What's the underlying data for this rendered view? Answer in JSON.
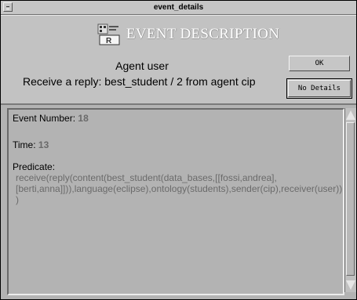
{
  "window": {
    "title": "event_details"
  },
  "header": {
    "heading": "EVENT DESCRIPTION",
    "agent_line": "Agent user",
    "reply_line": "Receive a reply: best_student / 2  from agent cip",
    "logo_icon": "event-logo-icon"
  },
  "buttons": {
    "ok_label": "OK",
    "details_label": "No Details"
  },
  "details": {
    "event_number_label": "Event Number:",
    "event_number_value": "18",
    "time_label": "Time:",
    "time_value": "13",
    "predicate_label": "Predicate:",
    "predicate_value": "receive(reply(content(best_student(data_bases,[[fossi,andrea],[berti,anna]])),language(eclipse),ontology(students),sender(cip),receiver(user)))"
  },
  "colors": {
    "panel": "#b3b3b3",
    "header": "#c2c2c2",
    "value_text": "#6a6a6a"
  }
}
